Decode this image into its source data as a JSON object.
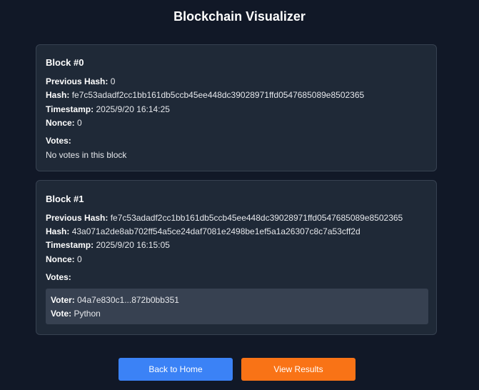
{
  "header": {
    "title": "Blockchain Visualizer"
  },
  "labels": {
    "previous_hash": "Previous Hash:",
    "hash": "Hash:",
    "timestamp": "Timestamp:",
    "nonce": "Nonce:",
    "votes": "Votes:",
    "voter": "Voter:",
    "vote": "Vote:"
  },
  "blocks": [
    {
      "title": "Block #0",
      "previous_hash": "0",
      "hash": "fe7c53adadf2cc1bb161db5ccb45ee448dc39028971ffd0547685089e8502365",
      "timestamp": "2025/9/20 16:14:25",
      "nonce": "0",
      "no_votes_text": "No votes in this block"
    },
    {
      "title": "Block #1",
      "previous_hash": "fe7c53adadf2cc1bb161db5ccb45ee448dc39028971ffd0547685089e8502365",
      "hash": "43a071a2de8ab702ff54a5ce24daf7081e2498be1ef5a1a26307c8c7a53cff2d",
      "timestamp": "2025/9/20 16:15:05",
      "nonce": "0",
      "votes": [
        {
          "voter": "04a7e830c1...872b0bb351",
          "vote": "Python"
        }
      ]
    }
  ],
  "actions": {
    "home_label": "Back to Home",
    "results_label": "View Results"
  },
  "colors": {
    "background": "#111827",
    "card": "#1f2937",
    "vote_box": "#374151",
    "primary": "#3b82f6",
    "secondary": "#f97316"
  }
}
